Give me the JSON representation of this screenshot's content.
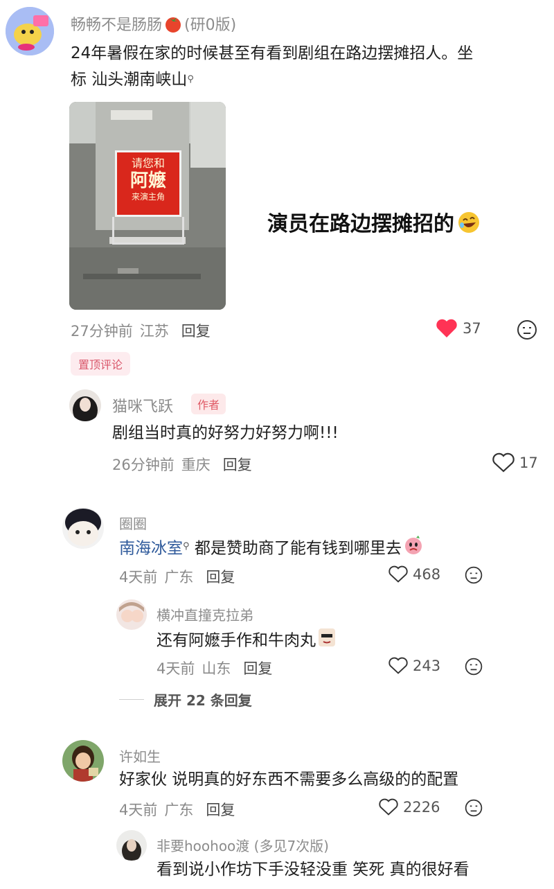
{
  "comment1": {
    "username": "畅畅不是肠肠",
    "badge": "(研0版)",
    "text_line1": "24年暑假在家的时候甚至有看到剧组在路边摆摊招人。坐",
    "text_line2": "标 汕头潮南峡山",
    "photo_sign": {
      "line1": "请您和",
      "line2": "阿嬷",
      "line3": "来演主角"
    },
    "caption": "演员在路边摆摊招的",
    "time": "27分钟前",
    "location": "江苏",
    "reply_label": "回复",
    "likes": "37",
    "pinned_label": "置顶评论"
  },
  "reply1": {
    "username": "猫咪飞跃",
    "author_tag": "作者",
    "text": "剧组当时真的好努力好努力啊!!!",
    "time": "26分钟前",
    "location": "重庆",
    "reply_label": "回复",
    "likes": "17"
  },
  "comment2": {
    "username": "圈圈",
    "mention": "南海冰室",
    "text": "都是赞助商了能有钱到哪里去",
    "time": "4天前",
    "location": "广东",
    "reply_label": "回复",
    "likes": "468"
  },
  "reply2": {
    "username": "横冲直撞克拉弟",
    "text": "还有阿嬷手作和牛肉丸",
    "time": "4天前",
    "location": "山东",
    "reply_label": "回复",
    "likes": "243",
    "expand_label": "展开 22 条回复"
  },
  "comment3": {
    "username": "许如生",
    "text": "好家伙 说明真的好东西不需要多么高级的的配置",
    "time": "4天前",
    "location": "广东",
    "reply_label": "回复",
    "likes": "2226"
  },
  "reply3": {
    "username": "非要hoohoo渡",
    "badge": "(多见7次版)",
    "text": "看到说小作坊下手没轻没重 笑死 真的很好看"
  },
  "colors": {
    "like_red": "#ff3355",
    "mention_blue": "#2f5a9b",
    "meta_gray": "#8a8a8a"
  }
}
